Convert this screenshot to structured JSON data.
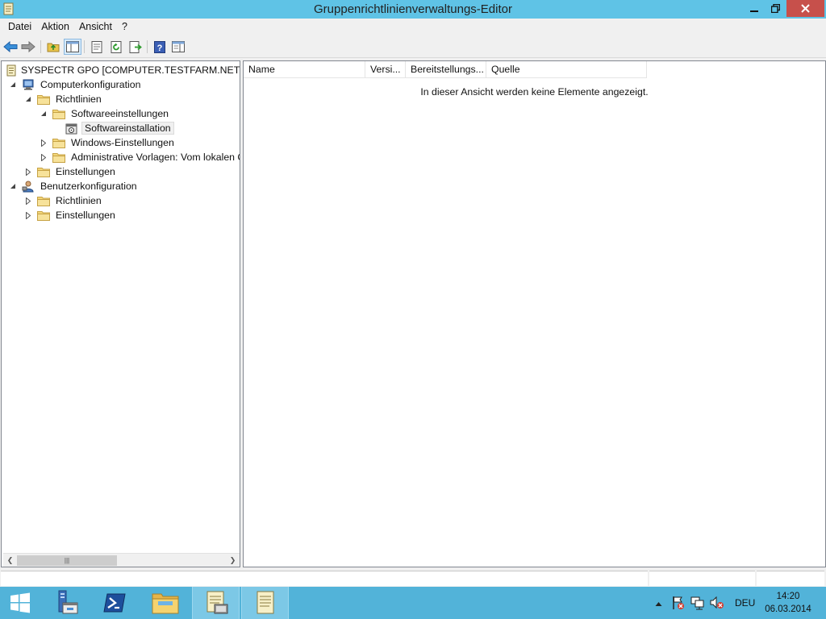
{
  "window": {
    "title": "Gruppenrichtlinienverwaltungs-Editor",
    "buttons": [
      "minimize",
      "maximize",
      "close"
    ]
  },
  "menu": {
    "items": [
      {
        "label": "Datei"
      },
      {
        "label": "Aktion"
      },
      {
        "label": "Ansicht"
      },
      {
        "label": "?"
      }
    ]
  },
  "toolbar": {
    "buttons": [
      "back-arrow-icon",
      "forward-arrow-icon",
      "up-folder-icon",
      "show-hide-tree-icon",
      "properties-icon",
      "refresh-icon",
      "export-list-icon",
      "help-icon",
      "show-hide-action-pane-icon"
    ]
  },
  "tree": {
    "root": "SYSPECTR GPO [COMPUTER.TESTFARM.NET ]",
    "items": [
      {
        "label": "Computerkonfiguration",
        "expanded": true
      },
      {
        "label": "Richtlinien",
        "expanded": true
      },
      {
        "label": "Softwareeinstellungen",
        "expanded": true
      },
      {
        "label": "Softwareinstallation",
        "selected": true
      },
      {
        "label": "Windows-Einstellungen",
        "expanded": false
      },
      {
        "label": "Administrative Vorlagen: Vom lokalen Co",
        "expanded": false
      },
      {
        "label": "Einstellungen",
        "expanded": false
      },
      {
        "label": "Benutzerkonfiguration",
        "expanded": true
      },
      {
        "label": "Richtlinien",
        "expanded": false
      },
      {
        "label": "Einstellungen",
        "expanded": false
      }
    ]
  },
  "list": {
    "columns": [
      "Name",
      "Versi...",
      "Bereitstellungs...",
      "Quelle"
    ],
    "empty_message": "In dieser Ansicht werden keine Elemente angezeigt."
  },
  "taskbar": {
    "apps": [
      "start-icon",
      "server-manager-icon",
      "powershell-icon",
      "explorer-icon",
      "gpmc-icon",
      "gp-editor-icon"
    ],
    "language": "DEU",
    "time": "14:20",
    "date": "06.03.2014"
  },
  "colors": {
    "titlebar": "#5fc3e6",
    "close_button": "#c7504b",
    "taskbar": "#52b3d9"
  }
}
